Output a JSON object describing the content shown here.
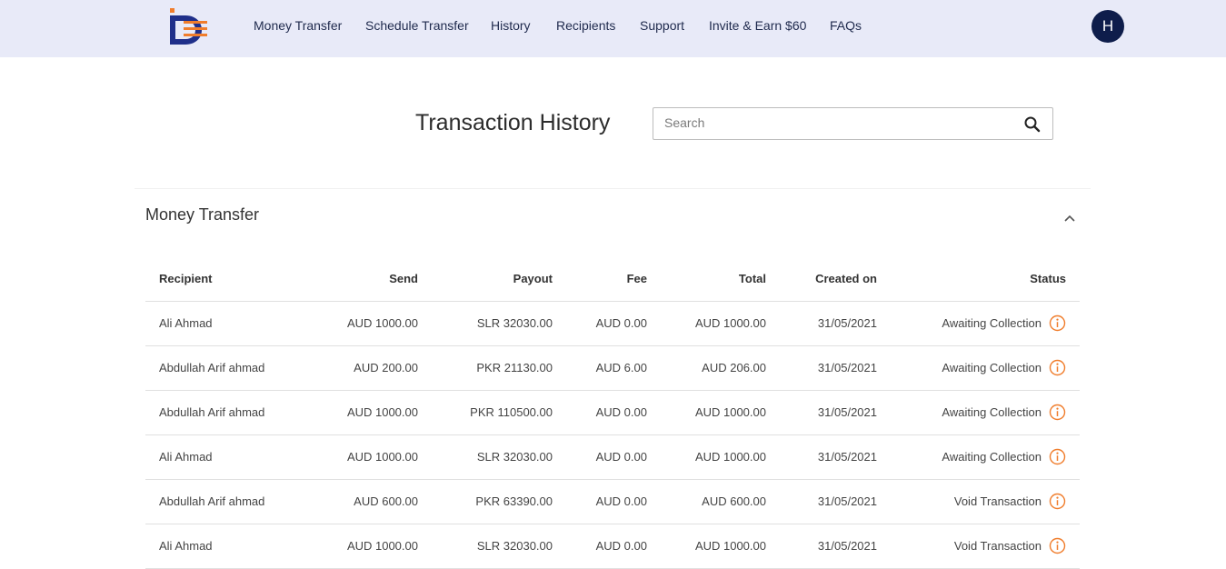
{
  "header": {
    "nav": [
      {
        "label": "Money Transfer"
      },
      {
        "label": "Schedule Transfer"
      },
      {
        "label": "History"
      },
      {
        "label": "Recipients"
      },
      {
        "label": "Support"
      },
      {
        "label": "Invite & Earn $60"
      },
      {
        "label": "FAQs"
      }
    ],
    "avatar_initial": "H",
    "avatar_color": "#0e1d4b"
  },
  "main": {
    "title": "Transaction History",
    "search": {
      "placeholder": "Search",
      "value": ""
    },
    "panel": {
      "title": "Money Transfer",
      "expanded": true,
      "columns": [
        "Recipient",
        "Send",
        "Payout",
        "Fee",
        "Total",
        "Created on",
        "Status"
      ],
      "rows": [
        {
          "recipient": "Ali Ahmad",
          "send": "AUD 1000.00",
          "payout": "SLR 32030.00",
          "fee": "AUD 0.00",
          "total": "AUD 1000.00",
          "created": "31/05/2021",
          "status": "Awaiting Collection"
        },
        {
          "recipient": "Abdullah Arif ahmad",
          "send": "AUD 200.00",
          "payout": "PKR 21130.00",
          "fee": "AUD 6.00",
          "total": "AUD 206.00",
          "created": "31/05/2021",
          "status": "Awaiting Collection"
        },
        {
          "recipient": "Abdullah Arif ahmad",
          "send": "AUD 1000.00",
          "payout": "PKR 110500.00",
          "fee": "AUD 0.00",
          "total": "AUD 1000.00",
          "created": "31/05/2021",
          "status": "Awaiting Collection"
        },
        {
          "recipient": "Ali Ahmad",
          "send": "AUD 1000.00",
          "payout": "SLR 32030.00",
          "fee": "AUD 0.00",
          "total": "AUD 1000.00",
          "created": "31/05/2021",
          "status": "Awaiting Collection"
        },
        {
          "recipient": "Abdullah Arif ahmad",
          "send": "AUD 600.00",
          "payout": "PKR 63390.00",
          "fee": "AUD 0.00",
          "total": "AUD 600.00",
          "created": "31/05/2021",
          "status": "Void Transaction"
        },
        {
          "recipient": "Ali Ahmad",
          "send": "AUD 1000.00",
          "payout": "SLR 32030.00",
          "fee": "AUD 0.00",
          "total": "AUD 1000.00",
          "created": "31/05/2021",
          "status": "Void Transaction"
        }
      ]
    }
  },
  "colors": {
    "header_bg": "#e8eaf8",
    "accent_orange": "#f07d2c",
    "brand_navy": "#1f2f8a"
  },
  "icons": {
    "search": "search-icon",
    "chevron": "chevron-up-icon",
    "status_info": "info-icon"
  }
}
